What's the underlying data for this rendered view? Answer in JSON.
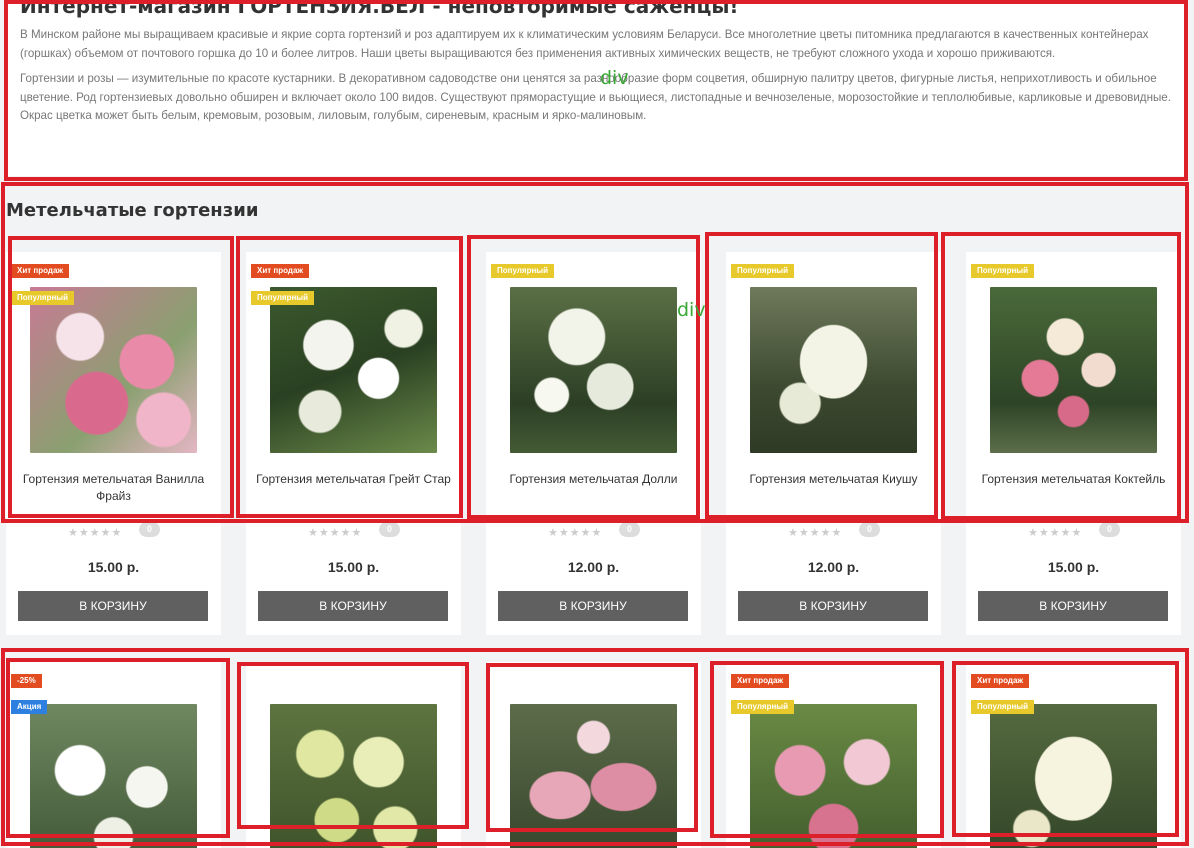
{
  "intro": {
    "title": "Интернет-магазин ГОРТЕНЗИЯ.БЕЛ - неповторимые саженцы!",
    "paragraph1": "В Минском районе мы выращиваем красивые и якрие сорта гортензий и роз адаптируем их к климатическим условиям Беларуси. Все многолетние цветы питомника предлагаются в качественных контейнерах (горшках) объемом от почтового горшка до 10 и более литров. Наши цветы выращиваются без применения активных химических веществ, не требуют сложного ухода и хорошо приживаются.",
    "paragraph2": "Гортензии и розы — изумительные по красоте кустарники. В декоративном садоводстве они ценятся за разнообразие форм соцветия, обширную палитру цветов, фигурные листья, неприхотливость и обильное цветение. Род гортензиевых довольно обширен и включает около 100 видов. Существуют пряморастущие и вьющиеся, листопадные и вечнозеленые, морозостойкие и теплолюбивые, карликовые и древовидные. Окрас цветка  может быть белым, кремовым, розовым, лиловым, голубым, сиреневым, красным и ярко-малиновым."
  },
  "section_title": "Метельчатые гортензии",
  "annotations": {
    "label1": "div",
    "label2": "div"
  },
  "rating_stars": "★★★★★",
  "cart_label": "В КОРЗИНУ",
  "products_row1": [
    {
      "badges": [
        "Хит продаж",
        "Популярный"
      ],
      "name": "Гортензия метельчатая Ванилла Фрайз",
      "price": "15.00 р.",
      "comments": "0"
    },
    {
      "badges": [
        "Хит продаж",
        "Популярный"
      ],
      "name": "Гортензия метельчатая Грейт Стар",
      "price": "15.00 р.",
      "comments": "0"
    },
    {
      "badges": [
        "Популярный"
      ],
      "name": "Гортензия метельчатая Долли",
      "price": "12.00 р.",
      "comments": "0"
    },
    {
      "badges": [
        "Популярный"
      ],
      "name": "Гортензия метельчатая Киушу",
      "price": "12.00 р.",
      "comments": "0"
    },
    {
      "badges": [
        "Популярный"
      ],
      "name": "Гортензия метельчатая Коктейль",
      "price": "15.00 р.",
      "comments": "0"
    }
  ],
  "products_row2": [
    {
      "badges": [
        "-25%",
        "Акция"
      ]
    },
    {
      "badges": []
    },
    {
      "badges": []
    },
    {
      "badges": [
        "Хит продаж",
        "Популярный"
      ]
    },
    {
      "badges": [
        "Хит продаж",
        "Популярный"
      ]
    }
  ],
  "colors": {
    "outline": "#dd1f2a",
    "annotation": "#3aa836",
    "hit": "#e24c20",
    "popular": "#e8c92c",
    "action": "#2d7fe0",
    "button": "#606060"
  }
}
